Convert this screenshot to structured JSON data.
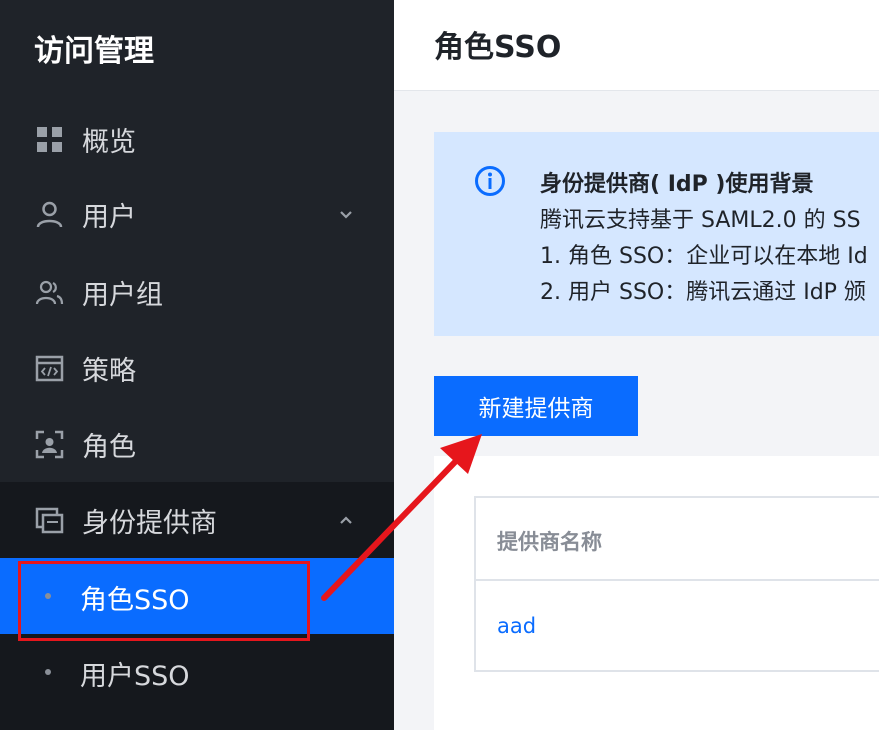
{
  "sidebar": {
    "title": "访问管理",
    "items": [
      {
        "label": "概览",
        "icon": "grid-icon"
      },
      {
        "label": "用户",
        "icon": "user-icon",
        "expandable": true
      },
      {
        "label": "用户组",
        "icon": "user-group-icon"
      },
      {
        "label": "策略",
        "icon": "policy-icon"
      },
      {
        "label": "角色",
        "icon": "role-icon"
      },
      {
        "label": "身份提供商",
        "icon": "identity-provider-icon",
        "expanded": true
      }
    ],
    "sub_items": [
      {
        "label": "角色SSO",
        "active": true
      },
      {
        "label": "用户SSO"
      }
    ]
  },
  "main": {
    "title": "角色SSO",
    "info": {
      "title": "身份提供商( IdP )使用背景",
      "lines": [
        "腾讯云支持基于 SAML2.0 的 SS",
        "1. 角色 SSO：企业可以在本地 Id",
        "2. 用户 SSO：腾讯云通过 IdP 颁"
      ]
    },
    "new_button": "新建提供商",
    "table": {
      "columns": [
        "提供商名称"
      ],
      "rows": [
        [
          "aad"
        ]
      ]
    }
  },
  "colors": {
    "sidebar_bg": "#1f2329",
    "accent": "#0a6cff",
    "info_bg": "#d5e7ff",
    "annotation": "#e6161c"
  }
}
